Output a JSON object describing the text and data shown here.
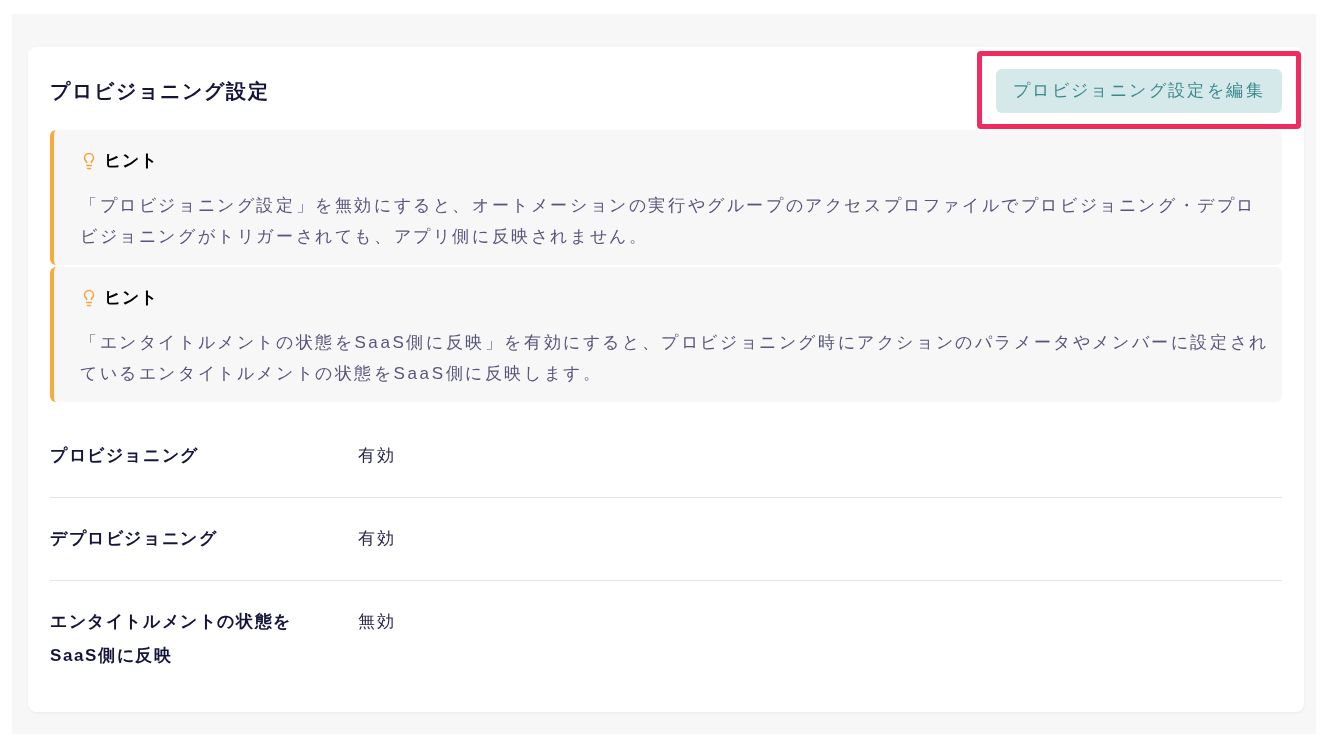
{
  "header": {
    "title": "プロビジョニング設定",
    "edit_button": {
      "label": "プロビジョニング設定を編集",
      "highlighted": true
    }
  },
  "hints": [
    {
      "title": "ヒント",
      "text": "「プロビジョニング設定」を無効にすると、オートメーションの実行やグループのアクセスプロファイルでプロビジョニング・デプロビジョニングがトリガーされても、アプリ側に反映されません。"
    },
    {
      "title": "ヒント",
      "text": "「エンタイトルメントの状態をSaaS側に反映」を有効にすると、プロビジョニング時にアクションのパラメータやメンバーに設定されているエンタイトルメントの状態をSaaS側に反映します。"
    }
  ],
  "settings": [
    {
      "label": "プロビジョニング",
      "value": "有効"
    },
    {
      "label": "デプロビジョニング",
      "value": "有効"
    },
    {
      "label": "エンタイトルメントの状態をSaaS側に反映",
      "value": "無効"
    }
  ]
}
